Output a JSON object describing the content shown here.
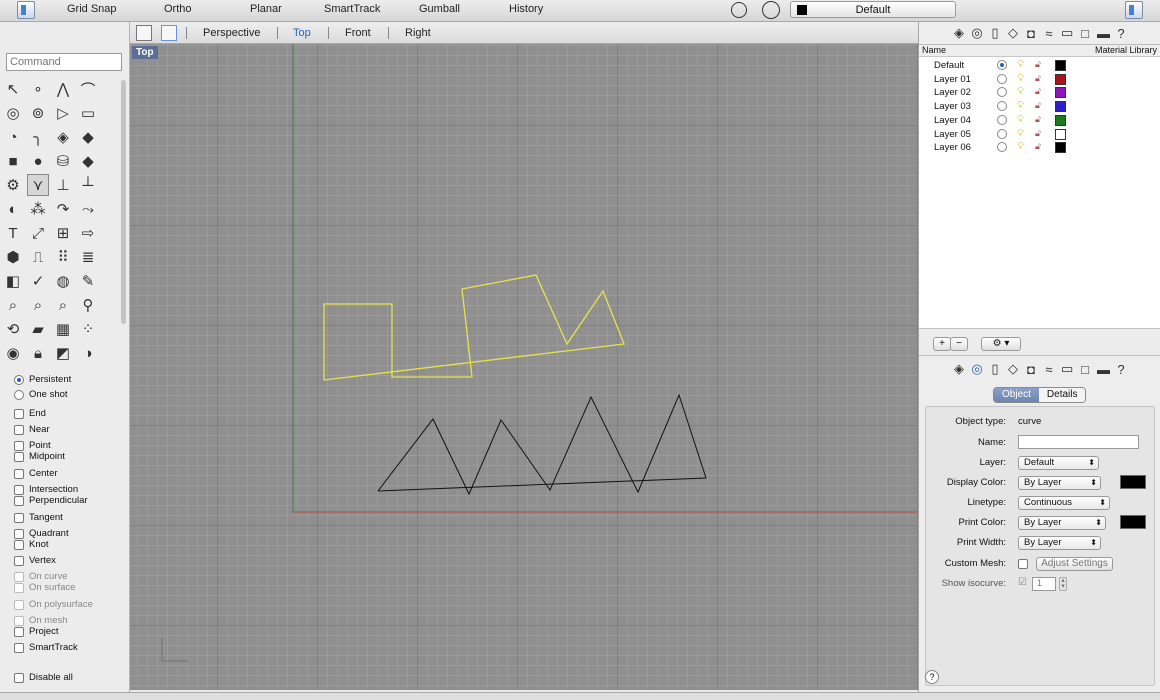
{
  "toolbar": {
    "items": [
      "Grid Snap",
      "Ortho",
      "Planar",
      "SmartTrack",
      "Gumball",
      "History"
    ],
    "layer_dropdown": "Default",
    "layer_swatch_color": "#000000"
  },
  "command": {
    "placeholder": "Command"
  },
  "viewport_tabs": {
    "items": [
      "Perspective",
      "Top",
      "Front",
      "Right"
    ],
    "active": "Top"
  },
  "viewport": {
    "label": "Top"
  },
  "osnap": {
    "mode": [
      {
        "label": "Persistent",
        "selected": true
      },
      {
        "label": "One shot",
        "selected": false
      }
    ],
    "items": [
      {
        "label": "End",
        "enabled": true
      },
      {
        "label": "Near",
        "enabled": true
      },
      {
        "label": "Point",
        "enabled": true
      },
      {
        "label": "Midpoint",
        "enabled": true
      },
      {
        "label": "Center",
        "enabled": true
      },
      {
        "label": "Intersection",
        "enabled": true
      },
      {
        "label": "Perpendicular",
        "enabled": true
      },
      {
        "label": "Tangent",
        "enabled": true
      },
      {
        "label": "Quadrant",
        "enabled": true
      },
      {
        "label": "Knot",
        "enabled": true
      },
      {
        "label": "Vertex",
        "enabled": true
      },
      {
        "label": "On curve",
        "enabled": false
      },
      {
        "label": "On surface",
        "enabled": false
      },
      {
        "label": "On polysurface",
        "enabled": false
      },
      {
        "label": "On mesh",
        "enabled": false
      },
      {
        "label": "Project",
        "enabled": true
      },
      {
        "label": "SmartTrack",
        "enabled": true
      },
      {
        "label": "Disable all",
        "enabled": true
      }
    ]
  },
  "layers": {
    "header": {
      "name": "Name",
      "material": "Material Library"
    },
    "rows": [
      {
        "name": "Default",
        "current": true,
        "color": "#000000"
      },
      {
        "name": "Layer 01",
        "current": false,
        "color": "#b0101a"
      },
      {
        "name": "Layer 02",
        "current": false,
        "color": "#8a18b8"
      },
      {
        "name": "Layer 03",
        "current": false,
        "color": "#2a1fc8"
      },
      {
        "name": "Layer 04",
        "current": false,
        "color": "#1e7a22"
      },
      {
        "name": "Layer 05",
        "current": false,
        "color": "#ffffff"
      },
      {
        "name": "Layer 06",
        "current": false,
        "color": "#000000"
      }
    ],
    "buttons": {
      "add": "+",
      "remove": "−",
      "settings": "⚙ ▾"
    }
  },
  "properties": {
    "tabs": [
      "Object",
      "Details"
    ],
    "active_tab": "Object",
    "object_type_label": "Object type:",
    "object_type": "curve",
    "name_label": "Name:",
    "layer_label": "Layer:",
    "layer_value": "Default",
    "display_color_label": "Display Color:",
    "display_color_value": "By Layer",
    "linetype_label": "Linetype:",
    "linetype_value": "Continuous",
    "print_color_label": "Print Color:",
    "print_color_value": "By Layer",
    "print_width_label": "Print Width:",
    "print_width_value": "By Layer",
    "custom_mesh_label": "Custom Mesh:",
    "adjust_settings": "Adjust Settings",
    "show_isocurve_label": "Show isocurve:",
    "isocurve_count": "1",
    "help": "?"
  },
  "colors": {
    "selected_curve": "#e8e24a",
    "black_curve": "#111111",
    "x_axis": "#b04a4a",
    "y_axis": "#4a7a4a"
  }
}
